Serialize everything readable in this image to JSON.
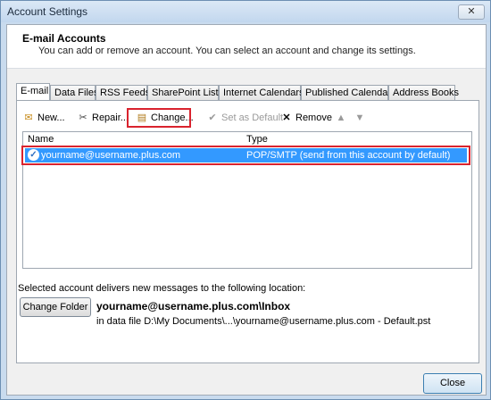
{
  "window": {
    "title": "Account Settings",
    "close_glyph": "✕"
  },
  "header": {
    "title": "E-mail Accounts",
    "subtitle": "You can add or remove an account. You can select an account and change its settings."
  },
  "tabs": [
    "E-mail",
    "Data Files",
    "RSS Feeds",
    "SharePoint Lists",
    "Internet Calendars",
    "Published Calendars",
    "Address Books"
  ],
  "toolbar": {
    "new": "New...",
    "repair": "Repair...",
    "change": "Change...",
    "set_default": "Set as Default",
    "remove": "Remove"
  },
  "list": {
    "col_name": "Name",
    "col_type": "Type",
    "rows": [
      {
        "name": "yourname@username.plus.com",
        "type": "POP/SMTP (send from this account by default)"
      }
    ]
  },
  "delivery": {
    "text": "Selected account delivers new messages to the following location:",
    "change_folder": "Change Folder",
    "inbox_path": "yourname@username.plus.com\\Inbox",
    "data_file": "in data file D:\\My Documents\\...\\yourname@username.plus.com - Default.pst"
  },
  "footer": {
    "close": "Close"
  },
  "colors": {
    "selection": "#3399ff",
    "highlight": "#d9232e"
  }
}
